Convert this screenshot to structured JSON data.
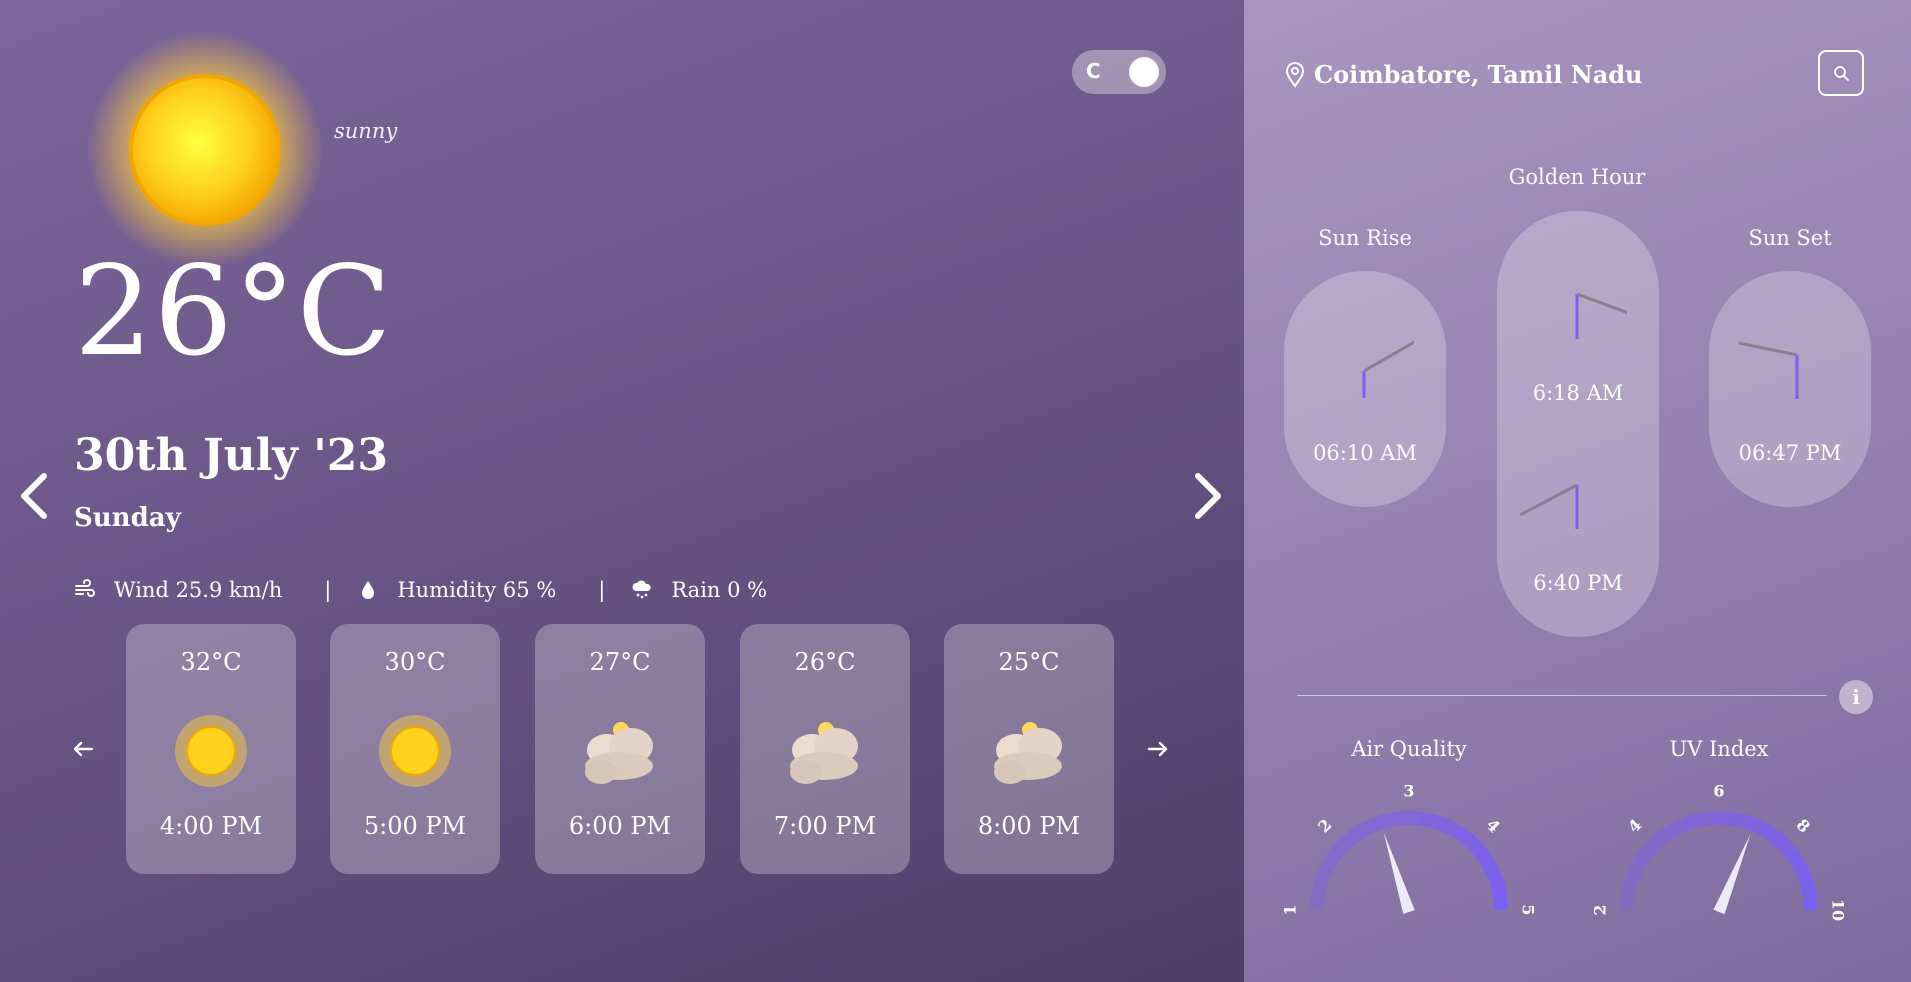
{
  "current": {
    "condition": "sunny",
    "temperature": "26°C",
    "date": "30th July '23",
    "day": "Sunday"
  },
  "unit_toggle": {
    "label": "C"
  },
  "stats": {
    "wind": "Wind 25.9 km/h",
    "humidity": "Humidity 65 %",
    "rain": "Rain 0 %",
    "separator": "|"
  },
  "hourly": [
    {
      "temp": "32°C",
      "time": "4:00 PM",
      "icon": "sun-icon"
    },
    {
      "temp": "30°C",
      "time": "5:00 PM",
      "icon": "sun-icon"
    },
    {
      "temp": "27°C",
      "time": "6:00 PM",
      "icon": "cloudy-icon"
    },
    {
      "temp": "26°C",
      "time": "7:00 PM",
      "icon": "cloudy-icon"
    },
    {
      "temp": "25°C",
      "time": "8:00 PM",
      "icon": "cloudy-icon"
    }
  ],
  "location": "Coimbatore, Tamil Nadu",
  "sun": {
    "golden_hour_title": "Golden Hour",
    "sunrise_title": "Sun Rise",
    "sunset_title": "Sun Set",
    "sunrise_time": "06:10 AM",
    "sunset_time": "06:47 PM",
    "golden_morning": "6:18 AM",
    "golden_evening": "6:40 PM"
  },
  "info_label": "i",
  "air_quality": {
    "title": "Air Quality",
    "ticks": [
      "1",
      "2",
      "3",
      "4",
      "5"
    ],
    "value": 2.6
  },
  "uv_index": {
    "title": "UV Index",
    "ticks": [
      "2",
      "4",
      "6",
      "8",
      "10"
    ],
    "value": 7.0
  },
  "colors": {
    "accent": "#7b5ff0",
    "clock_minute_hand": "#7b5ff0",
    "clock_hour_hand": "#8a7f8f"
  }
}
